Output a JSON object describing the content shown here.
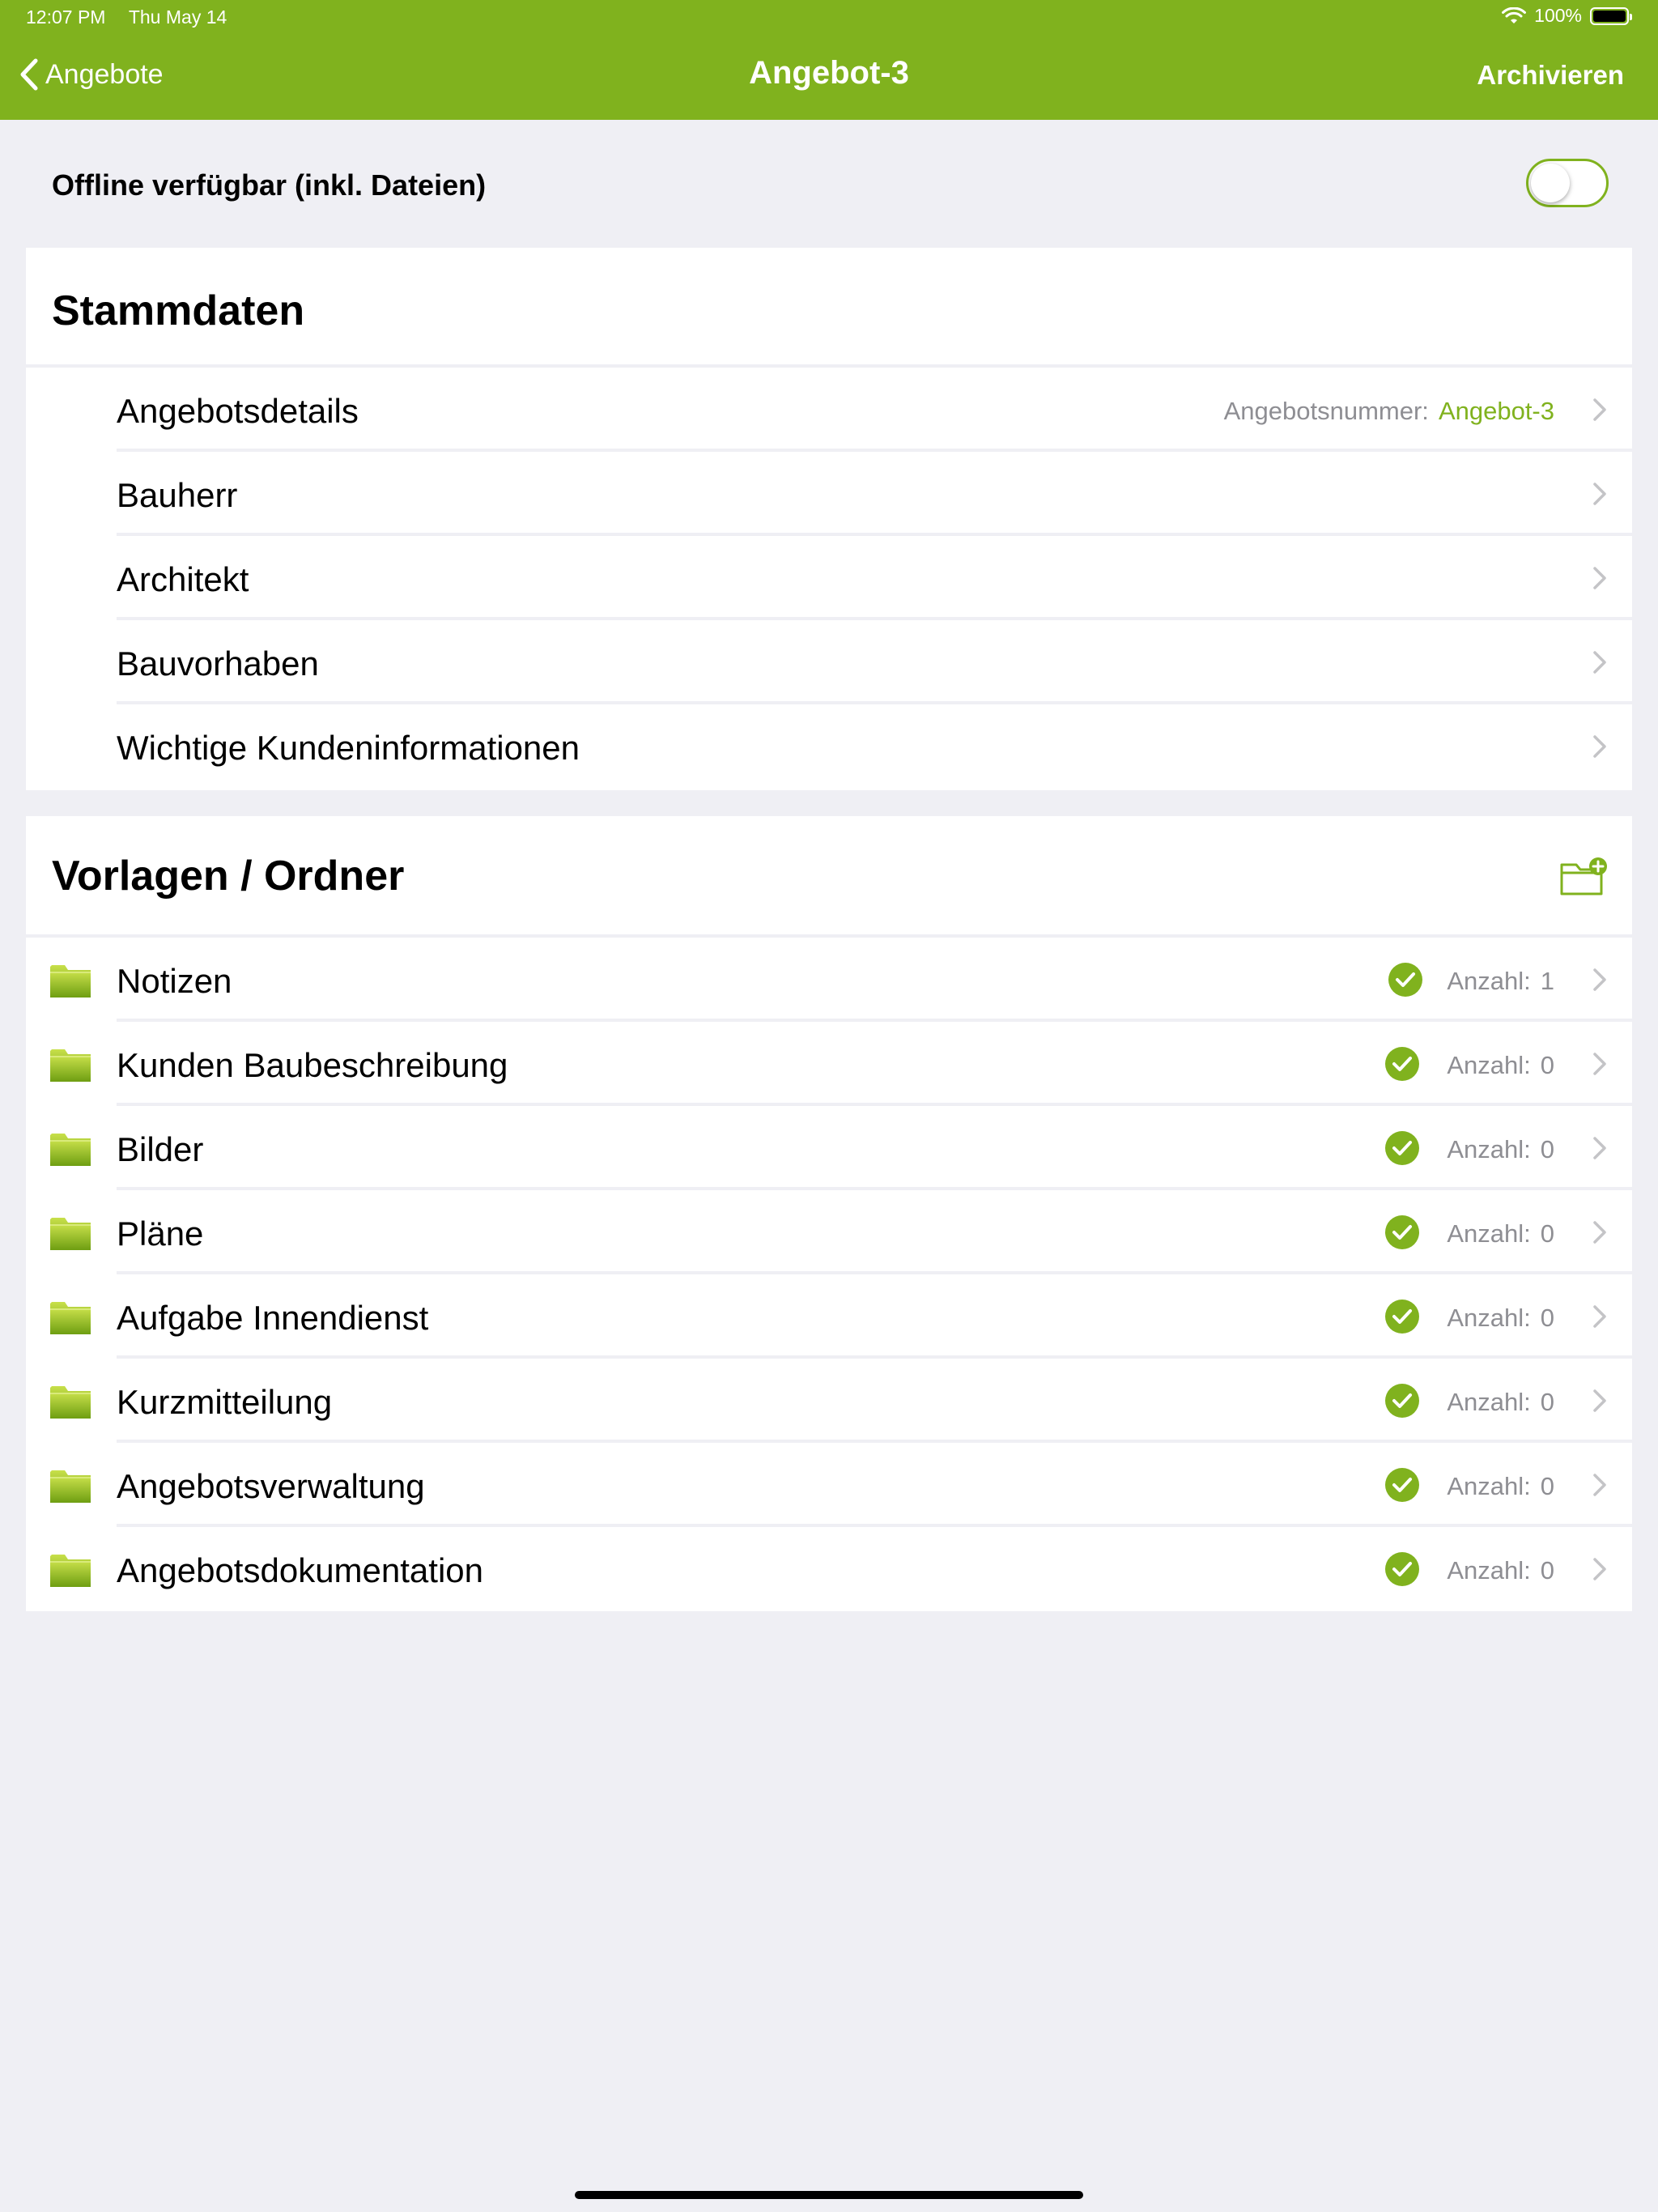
{
  "status_bar": {
    "time": "12:07 PM",
    "date": "Thu May 14",
    "battery": "100%",
    "wifi_icon": "wifi-icon",
    "battery_icon": "battery-icon"
  },
  "nav": {
    "back_label": "Angebote",
    "title": "Angebot-3",
    "action_label": "Archivieren"
  },
  "offline": {
    "label": "Offline verfügbar (inkl. Dateien)",
    "enabled": false
  },
  "stammdaten": {
    "title": "Stammdaten",
    "items": [
      {
        "label": "Angebotsdetails",
        "detail_key": "Angebotsnummer:",
        "detail_value": "Angebot-3"
      },
      {
        "label": "Bauherr"
      },
      {
        "label": "Architekt"
      },
      {
        "label": "Bauvorhaben"
      },
      {
        "label": "Wichtige Kundeninformationen"
      }
    ]
  },
  "vorlagen": {
    "title": "Vorlagen / Ordner",
    "add_icon": "folder-add-icon",
    "items": [
      {
        "label": "Notizen",
        "count_label": "Anzahl:",
        "count": "1"
      },
      {
        "label": "Kunden Baubeschreibung",
        "count_label": "Anzahl:",
        "count": "0"
      },
      {
        "label": "Bilder",
        "count_label": "Anzahl:",
        "count": "0"
      },
      {
        "label": "Pläne",
        "count_label": "Anzahl:",
        "count": "0"
      },
      {
        "label": "Aufgabe Innendienst",
        "count_label": "Anzahl:",
        "count": "0"
      },
      {
        "label": "Kurzmitteilung",
        "count_label": "Anzahl:",
        "count": "0"
      },
      {
        "label": "Angebotsverwaltung",
        "count_label": "Anzahl:",
        "count": "0"
      },
      {
        "label": "Angebotsdokumentation",
        "count_label": "Anzahl:",
        "count": "0"
      }
    ]
  },
  "colors": {
    "accent": "#80b21e",
    "background": "#efeff4",
    "secondary_text": "#8e8e93"
  }
}
